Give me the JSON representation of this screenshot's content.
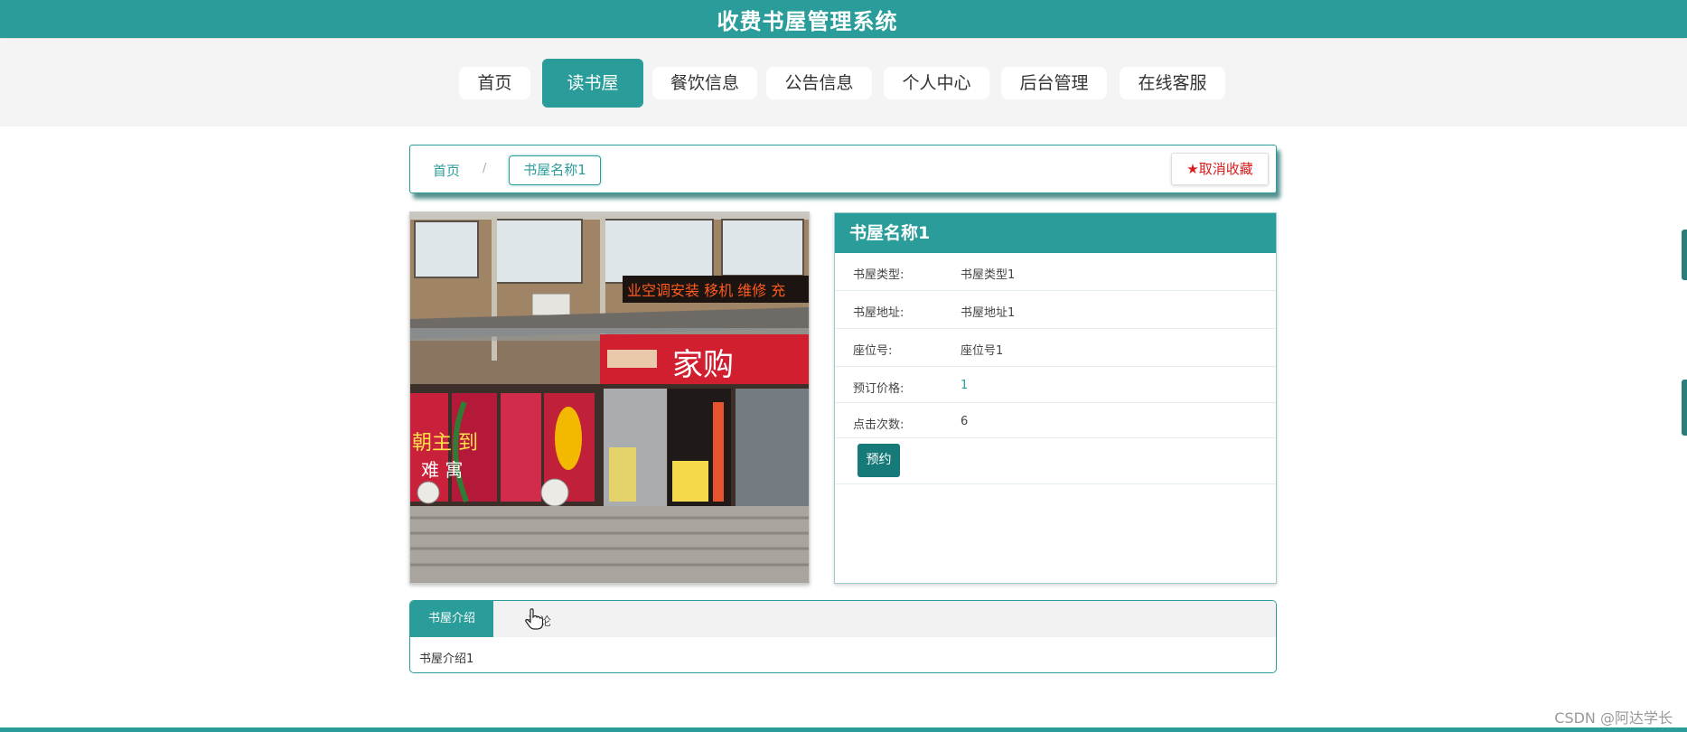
{
  "site": {
    "title": "收费书屋管理系统"
  },
  "nav": {
    "items": [
      {
        "label": "首页"
      },
      {
        "label": "读书屋"
      },
      {
        "label": "餐饮信息"
      },
      {
        "label": "公告信息"
      },
      {
        "label": "个人中心"
      },
      {
        "label": "后台管理"
      },
      {
        "label": "在线客服"
      }
    ],
    "active_index": 1
  },
  "breadcrumb": {
    "home": "首页",
    "separator": "/",
    "current": "书屋名称1"
  },
  "favorite": {
    "label": "取消收藏",
    "icon": "star-icon"
  },
  "detail": {
    "title": "书屋名称1",
    "rows": [
      {
        "label": "书屋类型:",
        "value": "书屋类型1"
      },
      {
        "label": "书屋地址:",
        "value": "书屋地址1"
      },
      {
        "label": "座位号:",
        "value": "座位号1"
      },
      {
        "label": "预订价格:",
        "value": "1"
      },
      {
        "label": "点击次数:",
        "value": "6"
      }
    ],
    "book_button": "预约"
  },
  "photo": {
    "shop_sign": "家购",
    "led_text": "业空调安装 移机 维修 充",
    "poster_text_1": "朝主 到",
    "poster_text_2": "难 寓"
  },
  "tabs": {
    "items": [
      {
        "label": "书屋介绍"
      },
      {
        "label": "评论"
      }
    ],
    "content": "书屋介绍1"
  },
  "footer": {
    "watermark": "CSDN @阿达学长"
  },
  "colors": {
    "primary": "#2a9d9a",
    "button_dark": "#167a78",
    "danger": "#d81b1b"
  }
}
